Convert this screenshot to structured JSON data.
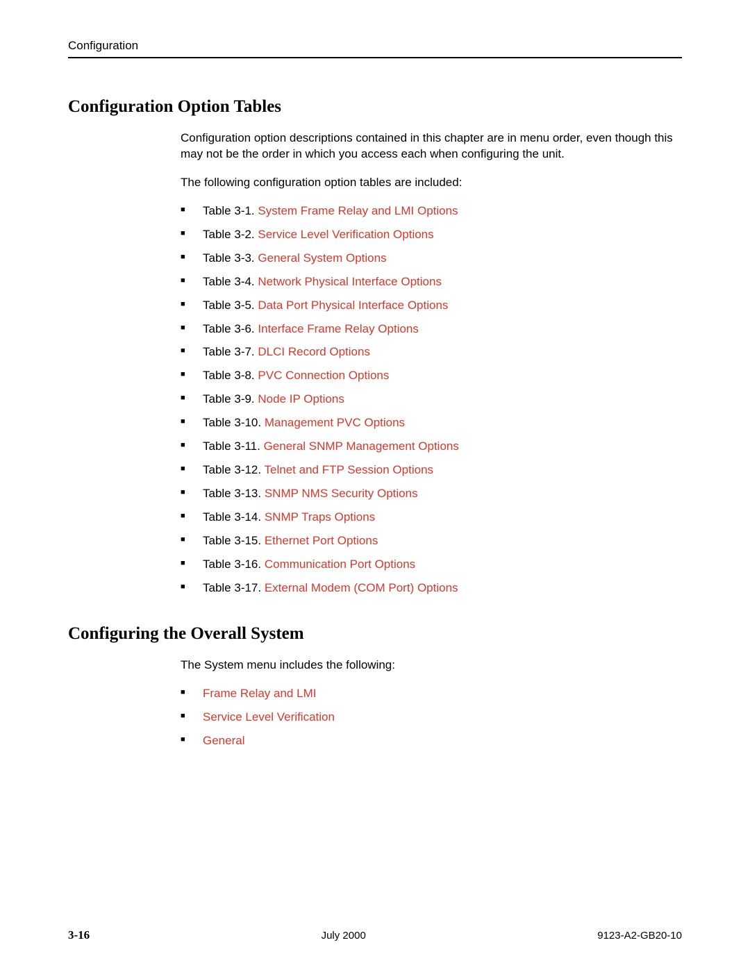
{
  "header": {
    "label": "Configuration"
  },
  "section1": {
    "heading": "Configuration Option Tables",
    "para1": "Configuration option descriptions contained in this chapter are in menu order, even though this may not be the order in which you access each when configuring the unit.",
    "para2": "The following configuration option tables are included:",
    "items": [
      {
        "prefix": "Table 3-1. ",
        "link": "System Frame Relay and LMI Options"
      },
      {
        "prefix": "Table 3-2. ",
        "link": "Service Level Verification Options"
      },
      {
        "prefix": "Table 3-3. ",
        "link": "General System Options"
      },
      {
        "prefix": "Table 3-4. ",
        "link": "Network Physical Interface Options"
      },
      {
        "prefix": "Table 3-5. ",
        "link": "Data Port Physical Interface Options"
      },
      {
        "prefix": "Table 3-6. ",
        "link": "Interface Frame Relay Options"
      },
      {
        "prefix": "Table 3-7. ",
        "link": "DLCI Record Options"
      },
      {
        "prefix": "Table 3-8. ",
        "link": "PVC Connection Options"
      },
      {
        "prefix": "Table 3-9. ",
        "link": "Node IP Options"
      },
      {
        "prefix": "Table 3-10. ",
        "link": "Management PVC Options"
      },
      {
        "prefix": "Table 3-11. ",
        "link": "General SNMP Management Options"
      },
      {
        "prefix": "Table 3-12. ",
        "link": "Telnet and FTP Session Options"
      },
      {
        "prefix": "Table 3-13. ",
        "link": "SNMP NMS Security Options"
      },
      {
        "prefix": "Table 3-14. ",
        "link": "SNMP Traps Options"
      },
      {
        "prefix": "Table 3-15. ",
        "link": "Ethernet Port Options"
      },
      {
        "prefix": "Table 3-16. ",
        "link": "Communication Port Options"
      },
      {
        "prefix": "Table 3-17. ",
        "link": "External Modem (COM Port) Options"
      }
    ]
  },
  "section2": {
    "heading": "Configuring the Overall System",
    "para1": "The System menu includes the following:",
    "items": [
      {
        "link": "Frame Relay and LMI"
      },
      {
        "link": "Service Level Verification"
      },
      {
        "link": "General"
      }
    ]
  },
  "footer": {
    "page": "3-16",
    "date": "July 2000",
    "docid": "9123-A2-GB20-10"
  }
}
